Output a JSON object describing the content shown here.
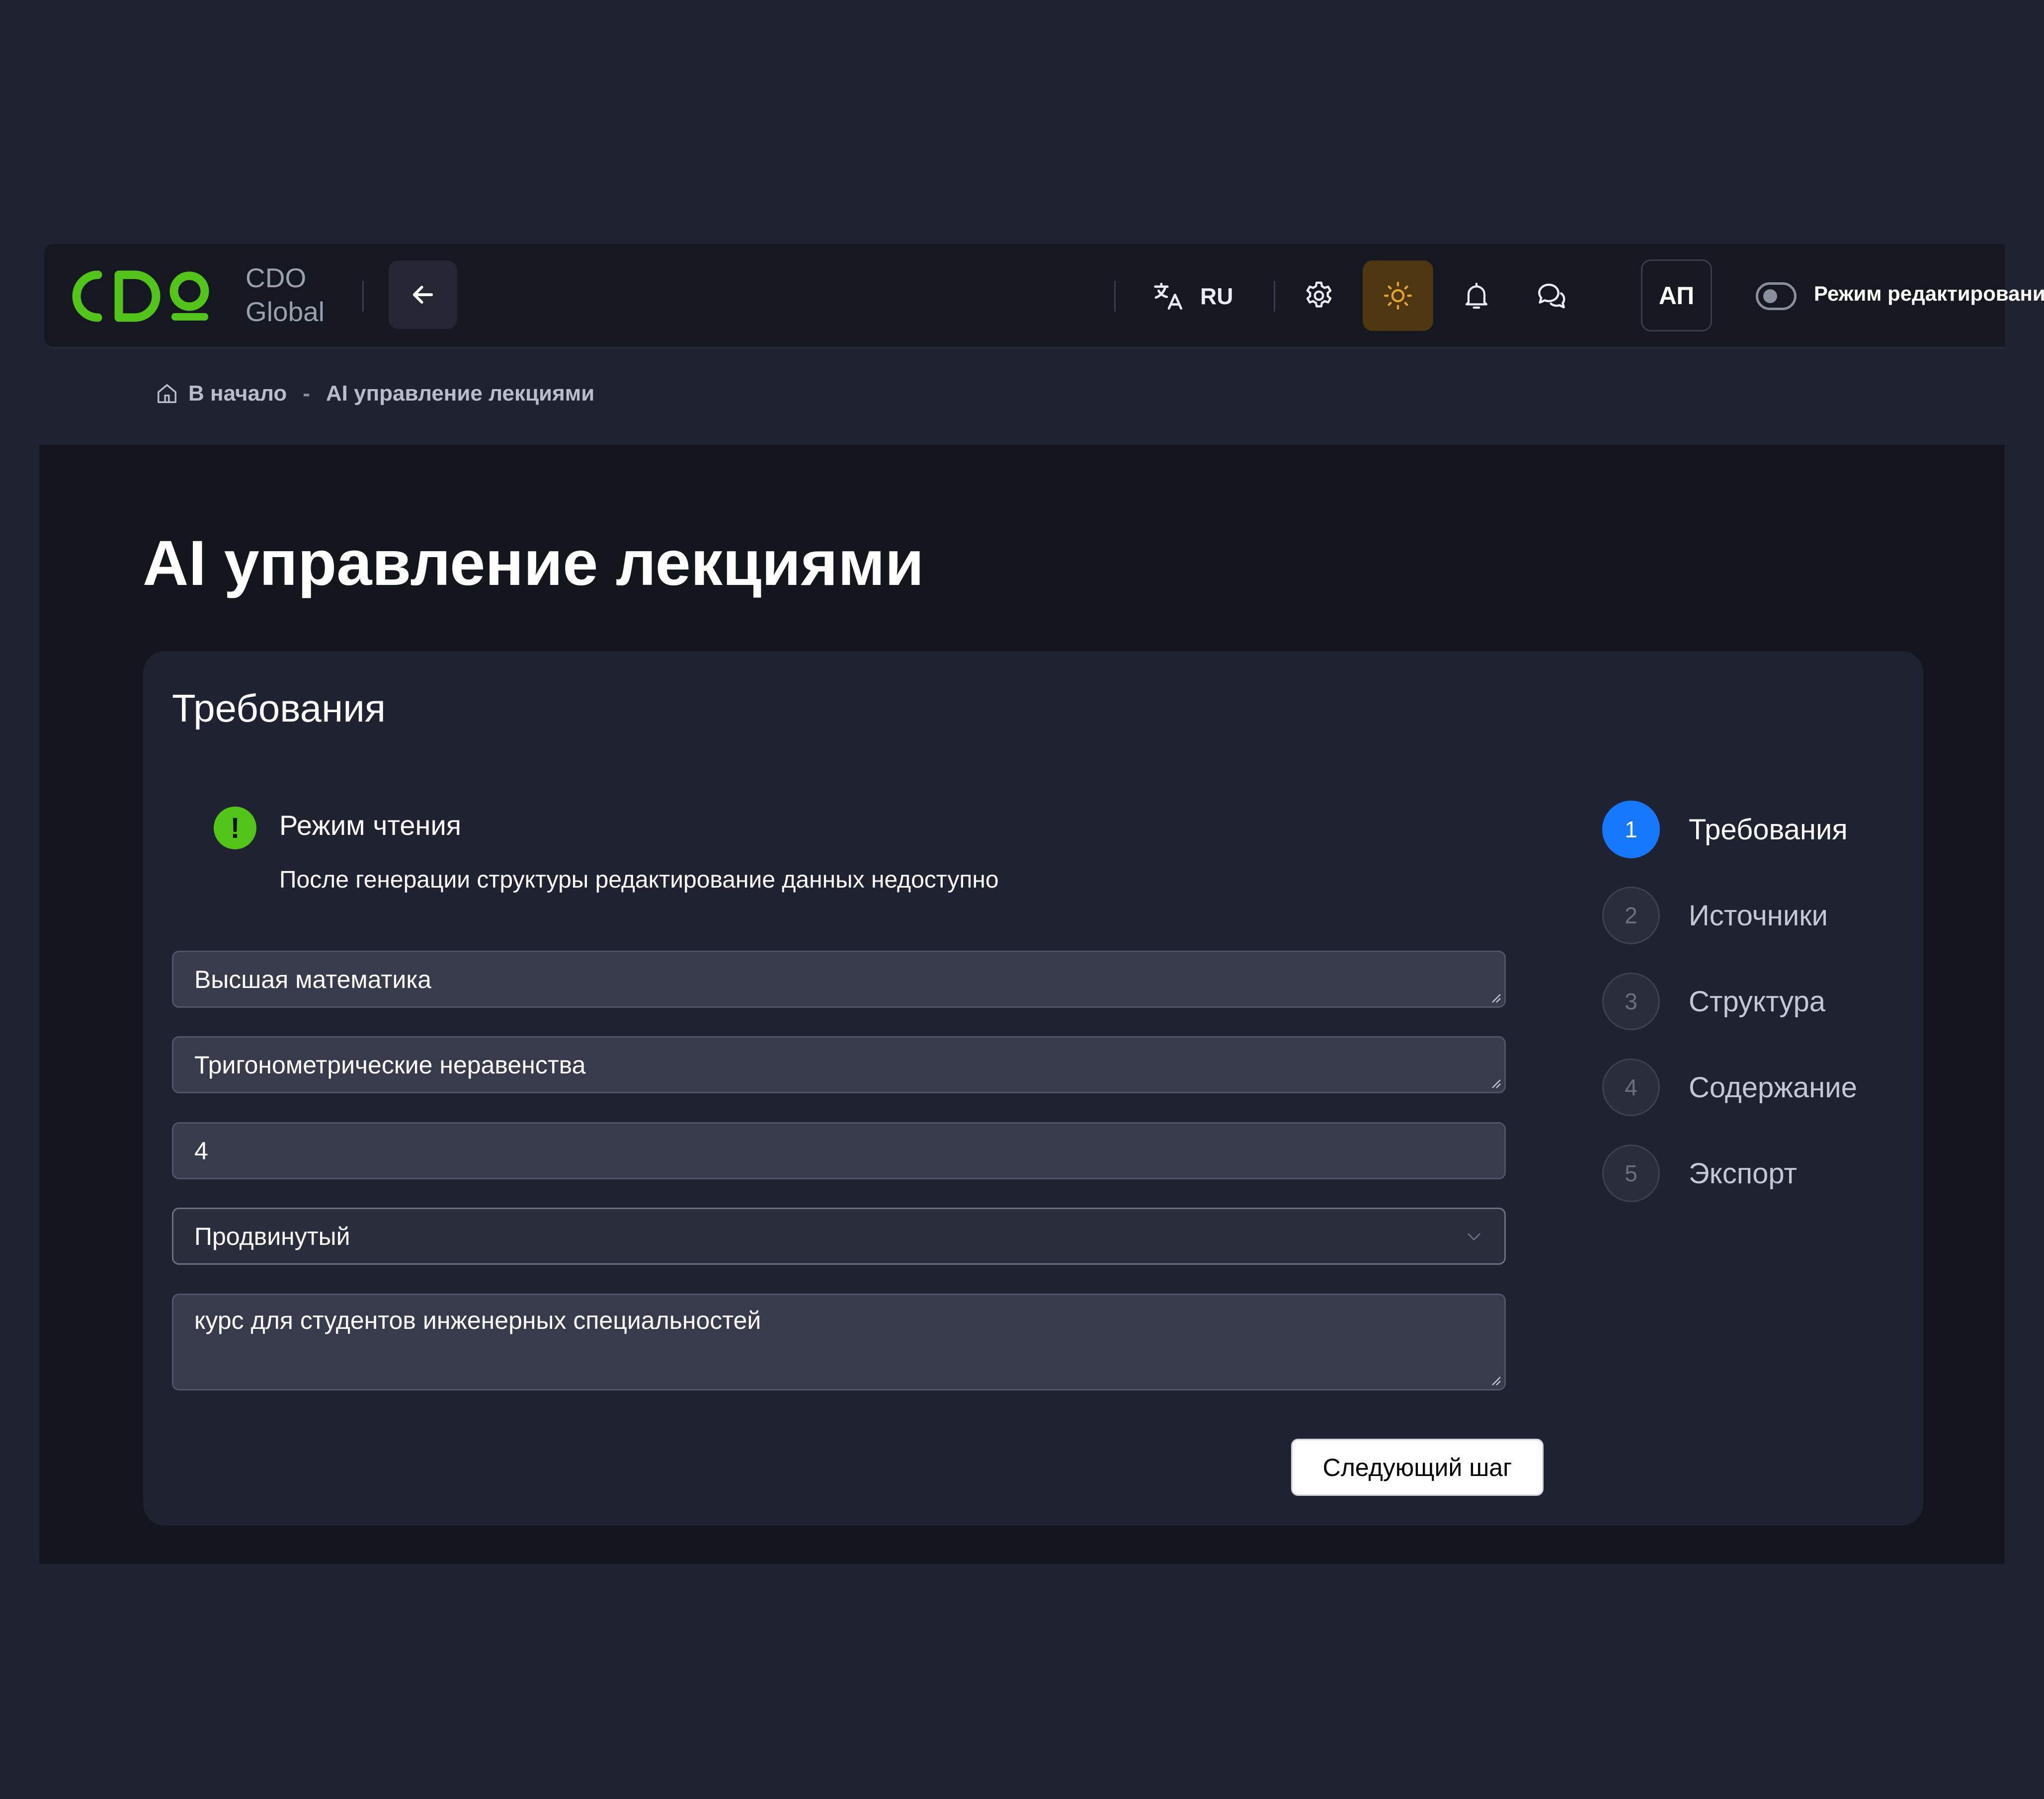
{
  "colors": {
    "page_bg": "#1f2230",
    "navbar_bg": "#161821",
    "main_bg": "#14161e",
    "card_bg": "#1f2230",
    "accent_green": "#52c41a",
    "step_active": "#1677ff",
    "theme_button_bg": "#4d3610",
    "sun_icon": "#e3a32c"
  },
  "header": {
    "logo_icon": "cdo-logo",
    "brand_line1": "CDO",
    "brand_line2": "Global",
    "back_icon": "arrow-left-icon",
    "language_icon": "translate-icon",
    "language": "RU",
    "settings_icon": "gear-icon",
    "theme_icon": "sun-icon",
    "notifications_icon": "bell-icon",
    "chat_icon": "chat-bubbles-icon",
    "avatar_initials": "АП",
    "edit_mode_label": "Режим редактирования",
    "edit_mode_enabled": false
  },
  "breadcrumb": {
    "home_icon": "home-icon",
    "home_label": "В начало",
    "separator": "-",
    "current": "AI управление лекциями"
  },
  "page": {
    "title": "AI управление лекциями"
  },
  "card": {
    "title": "Требования",
    "alert": {
      "icon": "exclamation-icon",
      "mark": "!",
      "title": "Режим чтения",
      "description": "После генерации структуры редактирование данных недоступно"
    },
    "fields": {
      "subject": "Высшая математика",
      "topic": "Тригонометрические неравенства",
      "count": "4",
      "level": "Продвинутый",
      "notes": "курс для студентов инженерных специальностей"
    },
    "next_button": "Следующий шаг"
  },
  "steps": [
    {
      "number": "1",
      "label": "Требования",
      "active": true
    },
    {
      "number": "2",
      "label": "Источники",
      "active": false
    },
    {
      "number": "3",
      "label": "Структура",
      "active": false
    },
    {
      "number": "4",
      "label": "Содержание",
      "active": false
    },
    {
      "number": "5",
      "label": "Экспорт",
      "active": false
    }
  ]
}
